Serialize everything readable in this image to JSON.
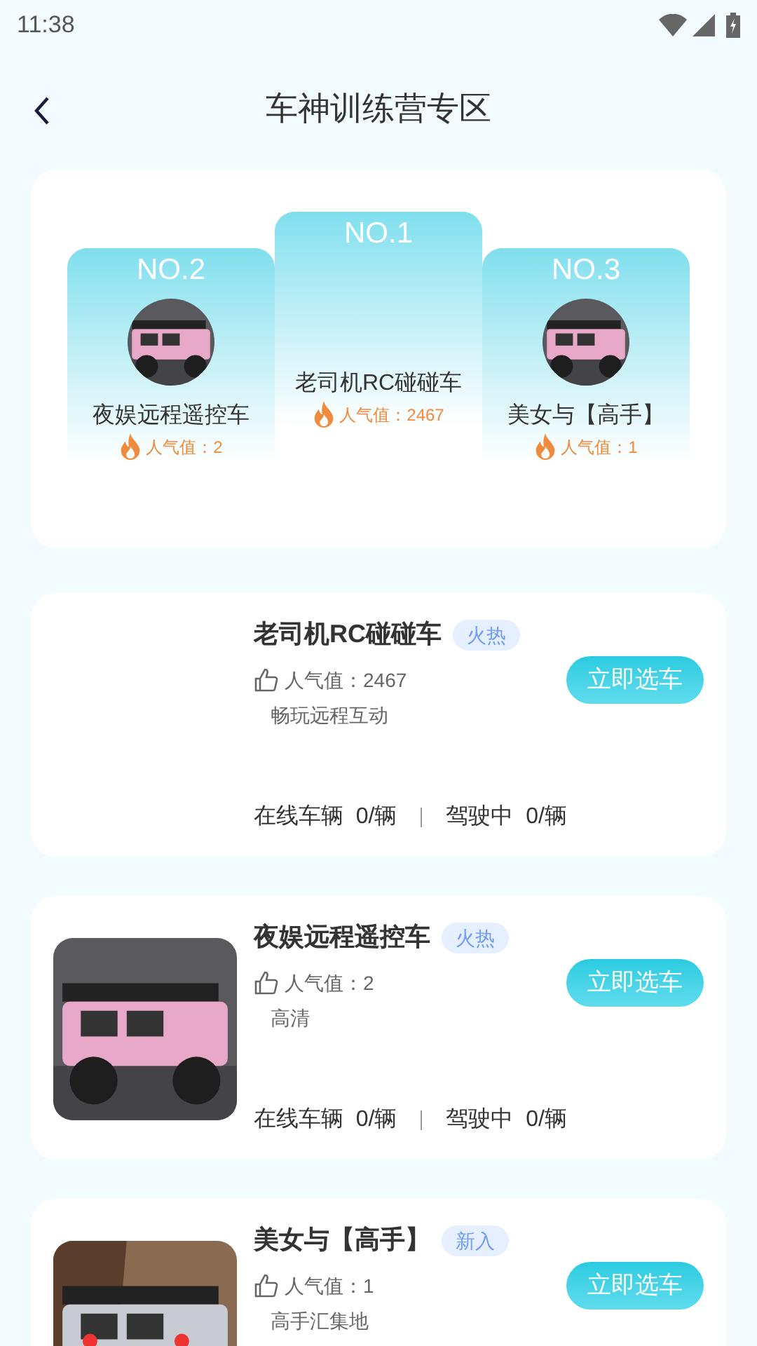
{
  "status_bar": {
    "time": "11:38"
  },
  "header": {
    "title": "车神训练营专区"
  },
  "podium": [
    {
      "rank": "NO.2",
      "raised": false,
      "name": "夜娱远程遥控车",
      "popularity": "人气值：2",
      "photo": true
    },
    {
      "rank": "NO.1",
      "raised": true,
      "name": "老司机RC碰碰车",
      "popularity": "人气值：2467",
      "photo": false
    },
    {
      "rank": "NO.3",
      "raised": false,
      "name": "美女与【高手】",
      "popularity": "人气值：1",
      "photo": true
    }
  ],
  "cars": [
    {
      "name": "老司机RC碰碰车",
      "tag": "火热",
      "popularity": "人气值：2467",
      "description": "畅玩远程互动",
      "button": "立即选车",
      "online": "在线车辆  0/辆",
      "driving": "驾驶中  0/辆",
      "photo": false
    },
    {
      "name": "夜娱远程遥控车",
      "tag": "火热",
      "popularity": "人气值：2",
      "description": "高清",
      "button": "立即选车",
      "online": "在线车辆  0/辆",
      "driving": "驾驶中  0/辆",
      "photo": true
    },
    {
      "name": "美女与【高手】",
      "tag": "新入",
      "popularity": "人气值：1",
      "description": "高手汇集地",
      "button": "立即选车",
      "photo": true
    }
  ]
}
